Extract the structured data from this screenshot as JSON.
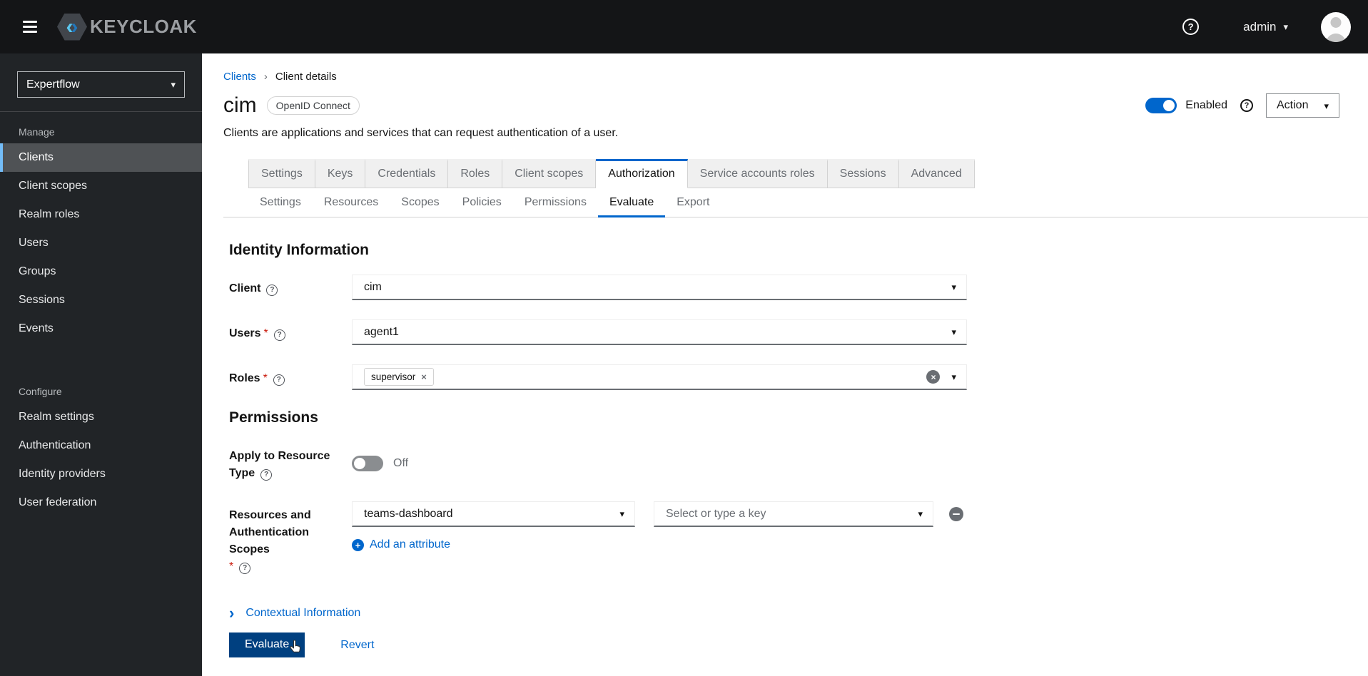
{
  "masthead": {
    "brand": "KEYCLOAK",
    "help_icon": "?",
    "username": "admin"
  },
  "sidebar": {
    "realm_selector": {
      "value": "Expertflow"
    },
    "groups": [
      {
        "label": "Manage",
        "items": [
          {
            "label": "Clients",
            "active": true
          },
          {
            "label": "Client scopes"
          },
          {
            "label": "Realm roles"
          },
          {
            "label": "Users"
          },
          {
            "label": "Groups"
          },
          {
            "label": "Sessions"
          },
          {
            "label": "Events"
          }
        ]
      },
      {
        "label": "Configure",
        "items": [
          {
            "label": "Realm settings"
          },
          {
            "label": "Authentication"
          },
          {
            "label": "Identity providers"
          },
          {
            "label": "User federation"
          }
        ]
      }
    ]
  },
  "breadcrumb": {
    "items": [
      "Clients",
      "Client details"
    ]
  },
  "header": {
    "title": "cim",
    "badge": "OpenID Connect",
    "description": "Clients are applications and services that can request authentication of a user.",
    "enabled_label": "Enabled",
    "action_label": "Action"
  },
  "tabs": {
    "main": [
      {
        "label": "Settings"
      },
      {
        "label": "Keys"
      },
      {
        "label": "Credentials"
      },
      {
        "label": "Roles"
      },
      {
        "label": "Client scopes"
      },
      {
        "label": "Authorization",
        "active": true
      },
      {
        "label": "Service accounts roles"
      },
      {
        "label": "Sessions"
      },
      {
        "label": "Advanced"
      }
    ],
    "sub": [
      {
        "label": "Settings"
      },
      {
        "label": "Resources"
      },
      {
        "label": "Scopes"
      },
      {
        "label": "Policies"
      },
      {
        "label": "Permissions"
      },
      {
        "label": "Evaluate",
        "active": true
      },
      {
        "label": "Export"
      }
    ]
  },
  "form": {
    "identity_section_title": "Identity Information",
    "client": {
      "label": "Client",
      "value": "cim"
    },
    "users": {
      "label": "Users",
      "required": "*",
      "value": "agent1"
    },
    "roles": {
      "label": "Roles",
      "required": "*",
      "chips": [
        {
          "label": "supervisor"
        }
      ]
    },
    "permissions_section_title": "Permissions",
    "apply_to_resource_type": {
      "label": "Apply to Resource Type",
      "state_label": "Off"
    },
    "resources_scopes": {
      "label": "Resources and Authentication Scopes",
      "required": "*",
      "resource_value": "teams-dashboard",
      "key_placeholder": "Select or type a key"
    },
    "add_attribute_label": "Add an attribute",
    "contextual_info_label": "Contextual Information",
    "evaluate_button_label": "Evaluate",
    "revert_label": "Revert"
  },
  "colors": {
    "accent": "#0066cc",
    "masthead_bg": "#141517",
    "sidebar_bg": "#212427",
    "sidebar_active_bg": "#4f5255",
    "sidebar_active_border": "#73bcf7",
    "evaluate_button_bg": "#004080",
    "toggle_on": "#0066cc",
    "toggle_off": "#8a8d90",
    "required_red": "#c9190b",
    "tab_inactive_bg": "#f0f0f0",
    "border_gray": "#d2d2d2"
  }
}
